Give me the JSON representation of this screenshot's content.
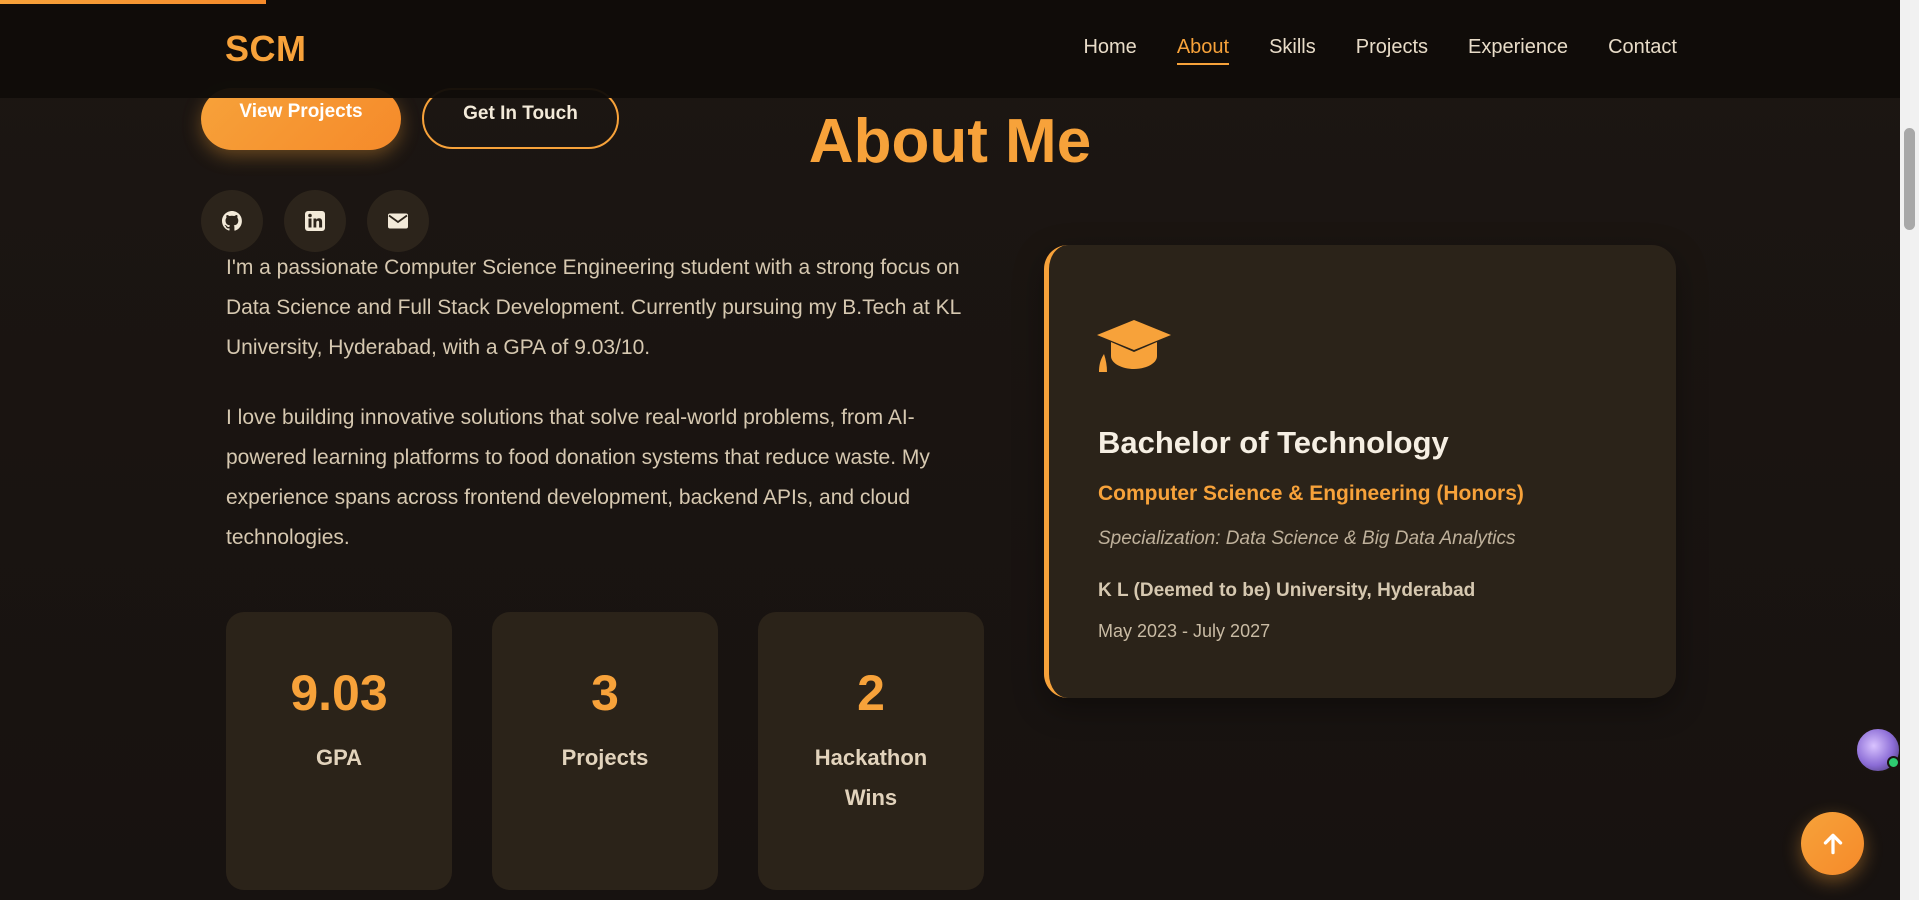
{
  "scroll_progress_fraction": 0.14,
  "navbar": {
    "logo": "SCM",
    "links": [
      "Home",
      "About",
      "Skills",
      "Projects",
      "Experience",
      "Contact"
    ],
    "active": "About"
  },
  "hero": {
    "primary_button": "View Projects",
    "secondary_button": "Get In Touch",
    "socials": [
      "github-icon",
      "linkedin-icon",
      "email-icon"
    ]
  },
  "about": {
    "title": "About Me",
    "paragraphs": [
      "I'm a passionate Computer Science Engineering student with a strong focus on Data Science and Full Stack Development. Currently pursuing my B.Tech at KL University, Hyderabad, with a GPA of 9.03/10.",
      "I love building innovative solutions that solve real-world problems, from AI-powered learning platforms to food donation systems that reduce waste. My experience spans across frontend development, backend APIs, and cloud technologies."
    ],
    "stats": [
      {
        "value": "9.03",
        "label": "GPA"
      },
      {
        "value": "3",
        "label": "Projects"
      },
      {
        "value": "2",
        "label": "Hackathon Wins"
      }
    ],
    "education": {
      "icon": "graduation-cap-icon",
      "degree": "Bachelor of Technology",
      "major": "Computer Science & Engineering (Honors)",
      "specialization": "Specialization: Data Science & Big Data Analytics",
      "university": "K L (Deemed to be) University, Hyderabad",
      "dates": "May 2023 - July 2027"
    }
  },
  "colors": {
    "accent": "#f7a23a",
    "background": "#1a1410",
    "card": "#2b2319"
  }
}
